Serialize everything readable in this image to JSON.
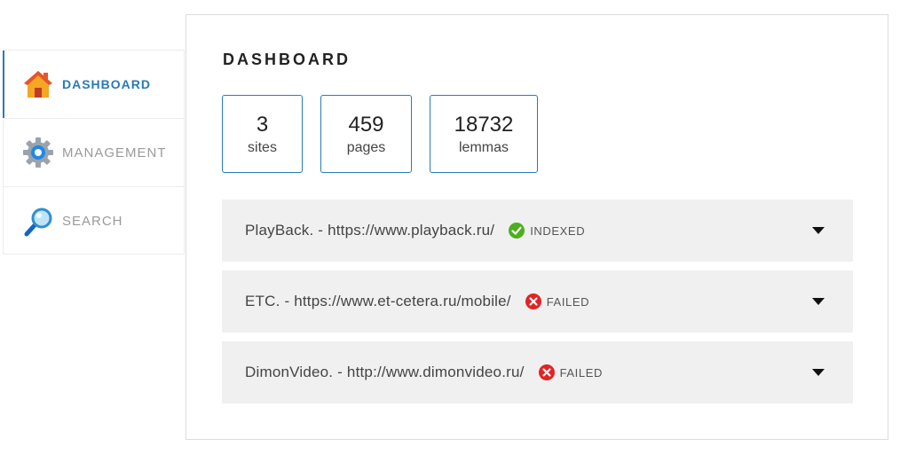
{
  "sidebar": {
    "items": [
      {
        "label": "DASHBOARD",
        "icon": "home-icon",
        "active": true
      },
      {
        "label": "MANAGEMENT",
        "icon": "gear-icon",
        "active": false
      },
      {
        "label": "SEARCH",
        "icon": "magnifier-icon",
        "active": false
      }
    ]
  },
  "main": {
    "title": "DASHBOARD",
    "stats": [
      {
        "value": "3",
        "label": "sites"
      },
      {
        "value": "459",
        "label": "pages"
      },
      {
        "value": "18732",
        "label": "lemmas"
      }
    ],
    "sites": [
      {
        "text": "PlayBack. - https://www.playback.ru/",
        "status": "INDEXED",
        "status_icon": "check-circle-icon"
      },
      {
        "text": "ETC. - https://www.et-cetera.ru/mobile/",
        "status": "FAILED",
        "status_icon": "error-circle-icon"
      },
      {
        "text": "DimonVideo. - http://www.dimonvideo.ru/",
        "status": "FAILED",
        "status_icon": "error-circle-icon"
      }
    ]
  },
  "colors": {
    "accent": "#2a7ab5",
    "indexed": "#4caf1e",
    "failed": "#e02424",
    "row_bg": "#f0f0f0"
  }
}
